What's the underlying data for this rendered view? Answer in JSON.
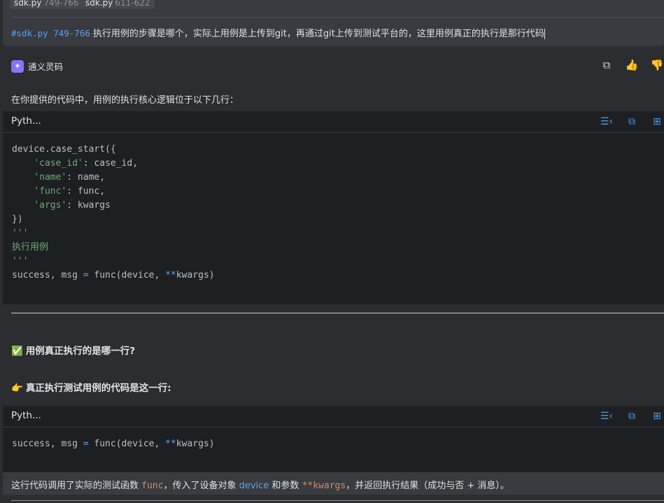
{
  "prompt": {
    "files": [
      {
        "name": "sdk.py",
        "range": "749-766"
      },
      {
        "name": "sdk.py",
        "range": "611-622"
      }
    ],
    "ref": "#sdk.py 749-766",
    "text": "执行用例的步骤是哪个，实际上用例是上传到git，再通过git上传到测试平台的，这里用例真正的执行是那行代码"
  },
  "agent": {
    "name": "通义灵码",
    "actions": [
      "copy-icon",
      "thumbs-up-icon",
      "thumbs-down-icon"
    ]
  },
  "answer": {
    "intro": "在你提供的代码中，用例的执行核心逻辑位于以下几行：",
    "code1": {
      "lang": "Pyth...",
      "lines": {
        "l1": "device.case_start({",
        "l2_key": "'case_id'",
        "l2_val": ": case_id,",
        "l3_key": "'name'",
        "l3_val": ": name,",
        "l4_key": "'func'",
        "l4_val": ": func,",
        "l5_key": "'args'",
        "l5_val": ": kwargs",
        "l6": "})",
        "l7": "'''",
        "l8": "执行用例",
        "l9": "'''",
        "l10_a": "success, msg ",
        "l10_eq": "=",
        "l10_b": " func(device, ",
        "l10_star": "**",
        "l10_c": "kwargs)"
      }
    },
    "heading1": {
      "glyph": "✅",
      "text": "用例真正执行的是哪一行?"
    },
    "heading2": {
      "glyph": "👉",
      "text": "真正执行测试用例的代码是这一行:"
    },
    "code2": {
      "lang": "Pyth...",
      "line_a": "success, msg ",
      "line_eq": "=",
      "line_b": " func(device, ",
      "line_star": "**",
      "line_c": "kwargs)"
    },
    "summary": {
      "p1": "这行代码调用了实际的测试函数 ",
      "func": "func",
      "p2": "，传入了设备对象 ",
      "device": "device",
      "p3": " 和参数 ",
      "kwargs": "**kwargs",
      "p4": "，并返回执行结果（成功与否 + 消息）。"
    }
  },
  "colors": {
    "accent": "#5fa0f2",
    "string": "#6aab73",
    "keyword_orange": "#cf8e6d",
    "background": "#2b2d30",
    "code_background": "#1e1f22"
  }
}
